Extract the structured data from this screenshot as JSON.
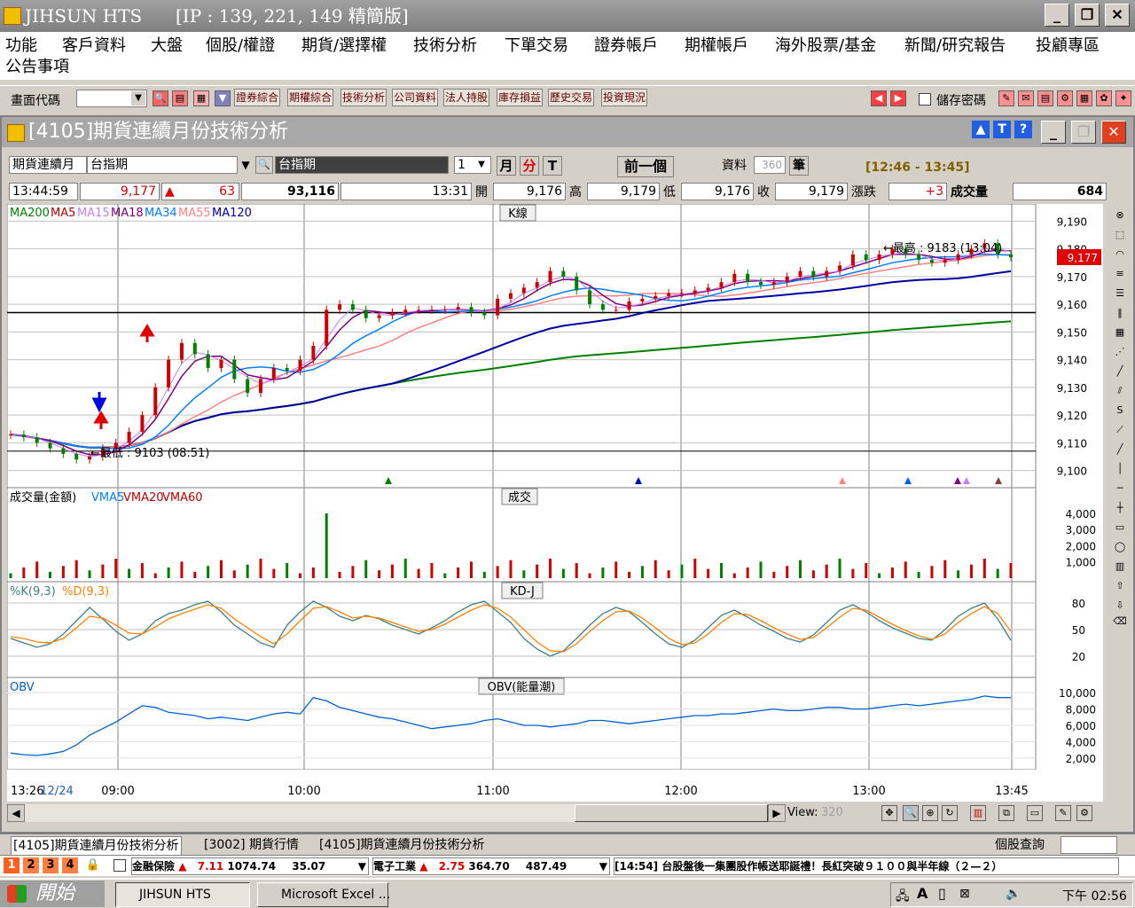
{
  "window": {
    "title": "JIHSUN HTS",
    "ip_info": "[IP : 139, 221, 149 精簡版]"
  },
  "menu": [
    "功能",
    "客戶資料",
    "大盤",
    "個股/權證",
    "期貨/選擇權",
    "技術分析",
    "下單交易",
    "證券帳戶",
    "期權帳戶",
    "海外股票/基金",
    "新聞/研究報告",
    "投顧專區",
    "公告事項"
  ],
  "toolbar": {
    "code_label": "畫面代碼",
    "shortcuts": [
      "證券綜合",
      "期權綜合",
      "技術分析",
      "公司資料",
      "法人持股",
      "庫存損益",
      "歷史交易",
      "投資現況"
    ],
    "save_pwd_label": "儲存密碼"
  },
  "child": {
    "title": "[4105]期貨連續月份技術分析",
    "product_type": "期貨連續月",
    "product_name": "台指期",
    "symbol_display": "台指期",
    "period_value": "1",
    "period_month": "月",
    "period_min": "分",
    "period_tick": "T",
    "prev_button": "前一個",
    "data_label": "資料",
    "data_count": "360",
    "data_unit": "筆",
    "time_range": "[12:46 - 13:45]"
  },
  "quote": {
    "time": "13:44:59",
    "price": "9,177",
    "change": "63",
    "volume_total": "93,116",
    "bar_time": "13:31",
    "open_label": "開",
    "open": "9,176",
    "high_label": "高",
    "high": "9,179",
    "low_label": "低",
    "low": "9,176",
    "close_label": "收",
    "close": "9,179",
    "diff_label": "漲跌",
    "diff": "+3",
    "vol_label": "成交量",
    "vol": "684"
  },
  "chart_data": {
    "type": "line",
    "panes": [
      {
        "name": "K線",
        "indicators": [
          "MA200",
          "MA5",
          "MA15",
          "MA18",
          "MA34",
          "MA55",
          "MA120"
        ],
        "indicator_colors": [
          "#008000",
          "#c00000",
          "#c080ff",
          "#800080",
          "#0080ff",
          "#ff8080",
          "#0000a0"
        ],
        "yticks": [
          9190,
          9180,
          9170,
          9160,
          9150,
          9140,
          9130,
          9120,
          9110,
          9100
        ],
        "ylim": [
          9097,
          9193
        ],
        "max_annotation": "←最高 : 9183 (13:04)",
        "min_annotation": "←最低 : 9103 (08:51)",
        "last_price_tag": "9,177",
        "reference_line": 9157
      },
      {
        "name": "成交",
        "title": "成交量(金額)",
        "indicators": [
          "VMA5",
          "VMA20",
          "VMA60"
        ],
        "indicator_colors": [
          "#0080ff",
          "#c00000",
          "#c00000"
        ],
        "yticks": [
          "4,000",
          "3,000",
          "2,000",
          "1,000"
        ]
      },
      {
        "name": "KD-J",
        "indicators": [
          "%K(9,3)",
          "%D(9,3)"
        ],
        "indicator_colors": [
          "#408080",
          "#ff8000"
        ],
        "yticks": [
          "80",
          "50",
          "20"
        ]
      },
      {
        "name": "OBV(能量潮)",
        "title": "OBV",
        "indicators": [
          "OBV"
        ],
        "indicator_colors": [
          "#0060d0"
        ],
        "yticks": [
          "10,000",
          "8,000",
          "6,000",
          "4,000",
          "2,000"
        ]
      }
    ],
    "xticks": [
      "13:26",
      "12/24",
      "09:00",
      "10:00",
      "11:00",
      "12:00",
      "13:00",
      "13:45"
    ],
    "close_series": [
      9113,
      9112,
      9110,
      9108,
      9106,
      9104,
      9105,
      9108,
      9110,
      9114,
      9120,
      9130,
      9140,
      9146,
      9142,
      9137,
      9140,
      9133,
      9128,
      9133,
      9137,
      9136,
      9140,
      9145,
      9158,
      9160,
      9158,
      9155,
      9156,
      9157,
      9158,
      9158,
      9158,
      9158,
      9159,
      9157,
      9156,
      9162,
      9164,
      9166,
      9168,
      9172,
      9170,
      9165,
      9160,
      9158,
      9158,
      9161,
      9162,
      9163,
      9164,
      9164,
      9165,
      9166,
      9168,
      9171,
      9168,
      9167,
      9168,
      9170,
      9172,
      9170,
      9172,
      9174,
      9178,
      9176,
      9178,
      9180,
      9178,
      9176,
      9175,
      9176,
      9178,
      9180,
      9182,
      9178,
      9177
    ],
    "kd_k": [
      40,
      35,
      30,
      34,
      45,
      60,
      75,
      62,
      48,
      38,
      45,
      60,
      68,
      72,
      78,
      82,
      70,
      55,
      45,
      35,
      30,
      55,
      70,
      82,
      75,
      65,
      60,
      66,
      62,
      55,
      50,
      45,
      52,
      60,
      70,
      78,
      82,
      70,
      58,
      40,
      28,
      20,
      26,
      40,
      55,
      68,
      75,
      70,
      58,
      45,
      34,
      30,
      38,
      52,
      66,
      72,
      64,
      55,
      48,
      40,
      36,
      44,
      58,
      72,
      78,
      70,
      60,
      52,
      46,
      40,
      38,
      50,
      65,
      74,
      80,
      62,
      38
    ],
    "kd_d": [
      42,
      40,
      36,
      35,
      40,
      52,
      65,
      63,
      55,
      46,
      45,
      53,
      62,
      68,
      73,
      78,
      74,
      62,
      52,
      42,
      34,
      45,
      60,
      74,
      76,
      70,
      63,
      65,
      63,
      58,
      53,
      48,
      50,
      56,
      64,
      72,
      78,
      74,
      64,
      50,
      36,
      26,
      25,
      34,
      48,
      60,
      70,
      71,
      63,
      52,
      40,
      33,
      35,
      45,
      58,
      68,
      67,
      60,
      52,
      45,
      39,
      41,
      52,
      64,
      74,
      72,
      64,
      56,
      49,
      43,
      39,
      45,
      58,
      68,
      76,
      68,
      48
    ],
    "obv": [
      2600,
      2400,
      2300,
      2500,
      2800,
      3600,
      4800,
      5600,
      6400,
      7400,
      8400,
      8200,
      7600,
      7400,
      7200,
      6800,
      7000,
      6800,
      6600,
      7000,
      7400,
      7600,
      7400,
      9400,
      9000,
      8200,
      7800,
      7400,
      7000,
      6800,
      6400,
      6000,
      5600,
      5800,
      6000,
      6200,
      6600,
      6800,
      6400,
      6000,
      6000,
      5800,
      6000,
      6200,
      6600,
      6600,
      6400,
      6200,
      6400,
      6600,
      6800,
      7000,
      7200,
      7200,
      7400,
      7400,
      7600,
      7800,
      8000,
      7800,
      7800,
      8000,
      8200,
      8200,
      8000,
      8000,
      8200,
      8400,
      8600,
      8400,
      8600,
      8800,
      9000,
      9200,
      9600,
      9400,
      9400
    ],
    "volume_spike_index": 24
  },
  "scrollbar": {
    "view_label": "View:",
    "view_value": "320"
  },
  "tabs": [
    "[4105]期貨連續月份技術分析",
    "[3002] 期貨行情",
    "[4105]期貨連續月份技術分析"
  ],
  "stock_query_label": "個股查詢",
  "ticker": {
    "pages": [
      "1",
      "2",
      "3",
      "4"
    ],
    "item1_name": "金融保險",
    "item1_change": "7.11",
    "item1_index": "1074.74",
    "item1_vol": "35.07",
    "item2_name": "電子工業",
    "item2_change": "2.75",
    "item2_index": "364.70",
    "item2_vol": "487.49",
    "news": "[14:54] 台股盤後一集團股作帳送耶誕禮！長紅突破９１００與半年線（２—２）"
  },
  "taskbar": {
    "start": "開始",
    "app1": "JIHSUN HTS",
    "app2": "Microsoft Excel ...",
    "clock": "下午 02:56"
  }
}
